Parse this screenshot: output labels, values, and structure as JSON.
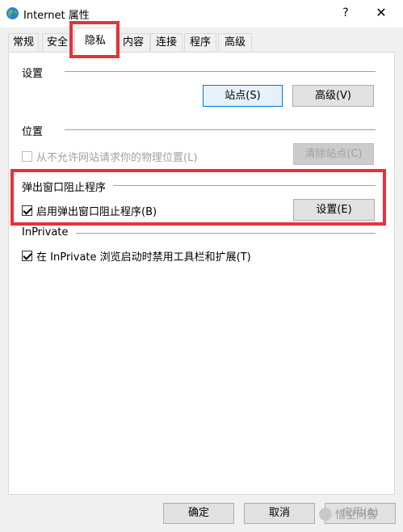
{
  "window": {
    "title": "Internet 属性",
    "help": "?",
    "close": "✕"
  },
  "tabs": [
    {
      "label": "常规"
    },
    {
      "label": "安全"
    },
    {
      "label": "隐私"
    },
    {
      "label": "内容"
    },
    {
      "label": "连接"
    },
    {
      "label": "程序"
    },
    {
      "label": "高级"
    }
  ],
  "settings": {
    "title": "设置",
    "sites_button": "站点(S)",
    "advanced_button": "高级(V)"
  },
  "location": {
    "title": "位置",
    "checkbox_label": "从不允许网站请求你的物理位置(L)",
    "checked": false,
    "clear_button": "清除站点(C)"
  },
  "popup": {
    "title": "弹出窗口阻止程序",
    "checkbox_label": "启用弹出窗口阻止程序(B)",
    "checked": true,
    "settings_button": "设置(E)"
  },
  "inprivate": {
    "title": "InPrivate",
    "checkbox_label": "在 InPrivate 浏览启动时禁用工具栏和扩展(T)",
    "checked": true
  },
  "footer": {
    "ok_button": "确定",
    "cancel_button": "取消",
    "apply_button": "应用(A)"
  },
  "watermark": {
    "text": "悟空问答"
  },
  "colors": {
    "highlight": "#e8303a",
    "accent": "#0078d7"
  }
}
